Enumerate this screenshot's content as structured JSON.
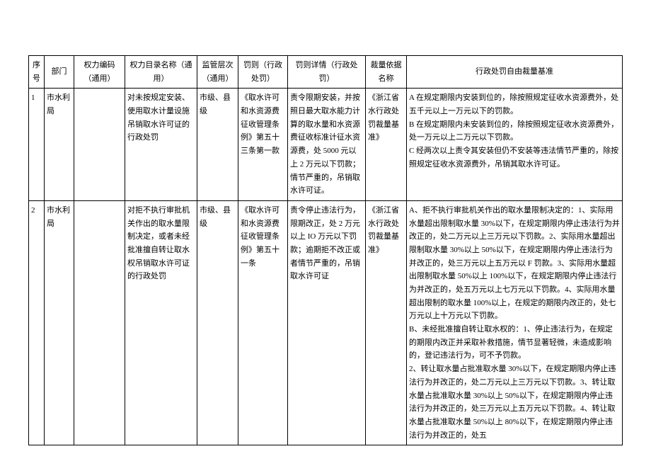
{
  "headers": {
    "seq": "序号",
    "dept": "部门",
    "code": "权力编码（通用）",
    "catalog": "权力目录名称（通用）",
    "level": "监管层次（通用）",
    "rule": "罚则（行政处罚）",
    "detail": "罚则详情（行政处罚）",
    "basis": "裁量依据名称",
    "standard": "行政处罚自由裁量基准"
  },
  "rows": [
    {
      "seq": "1",
      "dept": "市水利局",
      "code": "",
      "catalog": "对未按规定安装、使用取水计量设施吊销取水许可证的行政处罚",
      "level": "市级、县级",
      "rule": "《取水许可和水资源费征收管理条例》第五十三条第一款",
      "detail": "责令限期安装，并按照日最大取水能力计算的取水量和水资源费征收标准计征水资源费，处 5000 元以上 2 万元以下罚款；情节严重的，吊销取水许可证。",
      "basis": "《浙江省水行政处罚裁量基准》",
      "standard": "A 在规定期限内安装到位的，除按照规定征收水资源费外，处五千元以上一万元以下的罚款。\nB 在规定期限内未安装到位的，除按照规定征收水资源费外，处一万元以上二万元以下罚款。\nC 经两次以上责令其安装但仍不安装等违法情节严重的，除按照规定征收水资源费外，吊销其取水许可证。"
    },
    {
      "seq": "2",
      "dept": "市水利局",
      "code": "",
      "catalog": "对拒不执行审批机关作出的取水量限制决定，或者未经批准擅自转让取水权吊销取水许可证的行政处罚",
      "level": "市级、县级",
      "rule": "《取水许可和水资源费征收管理条例》第五十一条",
      "detail": "责令停止违法行为，限期改正，处 2 万元以上 IO 万元以下罚款；逾期拒不改正或者情节严重的，吊销取水许可证",
      "basis": "《浙江省水行政处罚裁量基准》",
      "standard": "A、拒不执行审批机关作出的取水量限制决定的：1、实际用水量超出限制取水量 30%以下，在规定期限内停止违法行为并改正的，处二万元以上三万元以下罚款。2、实际用水量超出限制取水量 30%以上 50%以下，在规定期限内停止违法行为并改正的，处三万元以上五万元以 F 罚款。3、实际用水量超出限制取水量 50%以上 100%以下，在规定期限内停止违法行为并改正的，处五万元以上七万元以下罚款。4、实际用水量超出限制的取水量 100%以上，在规定的期限内改正的，处七万元以上十万元以下罚款。\nB、未经批准擅自转让取水权的：1、停止违法行为，在规定的期限内改正并采取补救措施，情节显著轻微，未造成影响的，登记违法行为，可不予罚款。\n2、转让取水量占批准取水量 30%以下，在规定期限内停止违法行为并改正的，处二万元以上三万元以下罚款。3、转让取水量占批准取水量 30%以上 50%以下，在规定期限内停止违法行为并改正的，处三万元以上五万元以下罚款。4、转让取水量占批准取水量 50%以上 80%以下，在规定期限内停止违法行为并改正的，处五"
    }
  ]
}
